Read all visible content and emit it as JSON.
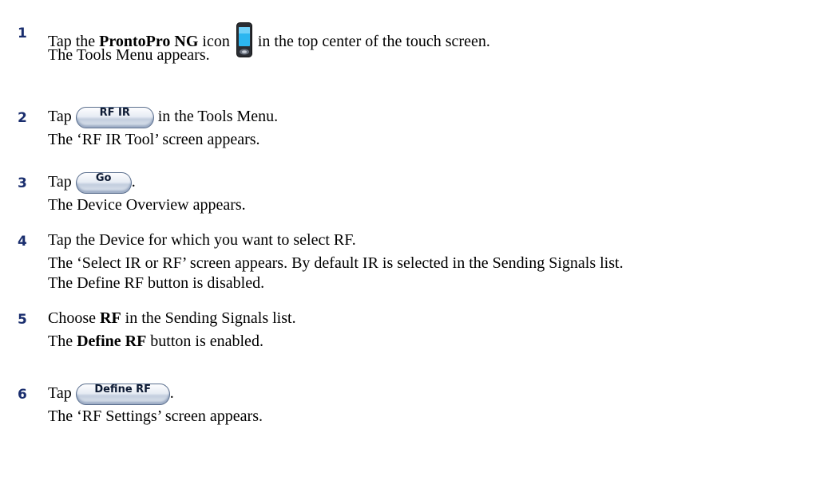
{
  "steps": [
    {
      "num": "1",
      "before": "Tap the ",
      "bold": "ProntoPro NG",
      "after_bold": " icon",
      "after_icon": " in the top center of the touch screen.",
      "result": "The Tools Menu appears."
    },
    {
      "num": "2",
      "before": "Tap ",
      "button": "RF IR",
      "after": " in the Tools Menu.",
      "result": "The ‘RF IR Tool’ screen appears."
    },
    {
      "num": "3",
      "before": "Tap ",
      "button": "Go",
      "after": ".",
      "result": "The Device Overview appears."
    },
    {
      "num": "4",
      "text": "Tap the Device for which you want to select RF.",
      "result1": "The ‘Select IR or RF’ screen appears. By default IR is selected in the Sending Signals list.",
      "result2": "The Define RF button is disabled."
    },
    {
      "num": "5",
      "before": "Choose ",
      "bold": "RF",
      "after": " in the Sending Signals list.",
      "result_before": "The ",
      "result_bold": "Define RF",
      "result_after": " button is enabled."
    },
    {
      "num": "6",
      "before": "Tap ",
      "button": "Define RF",
      "after": ".",
      "result": "The ‘RF Settings’ screen appears."
    }
  ],
  "icons": {
    "device": "pronto-device-icon"
  }
}
